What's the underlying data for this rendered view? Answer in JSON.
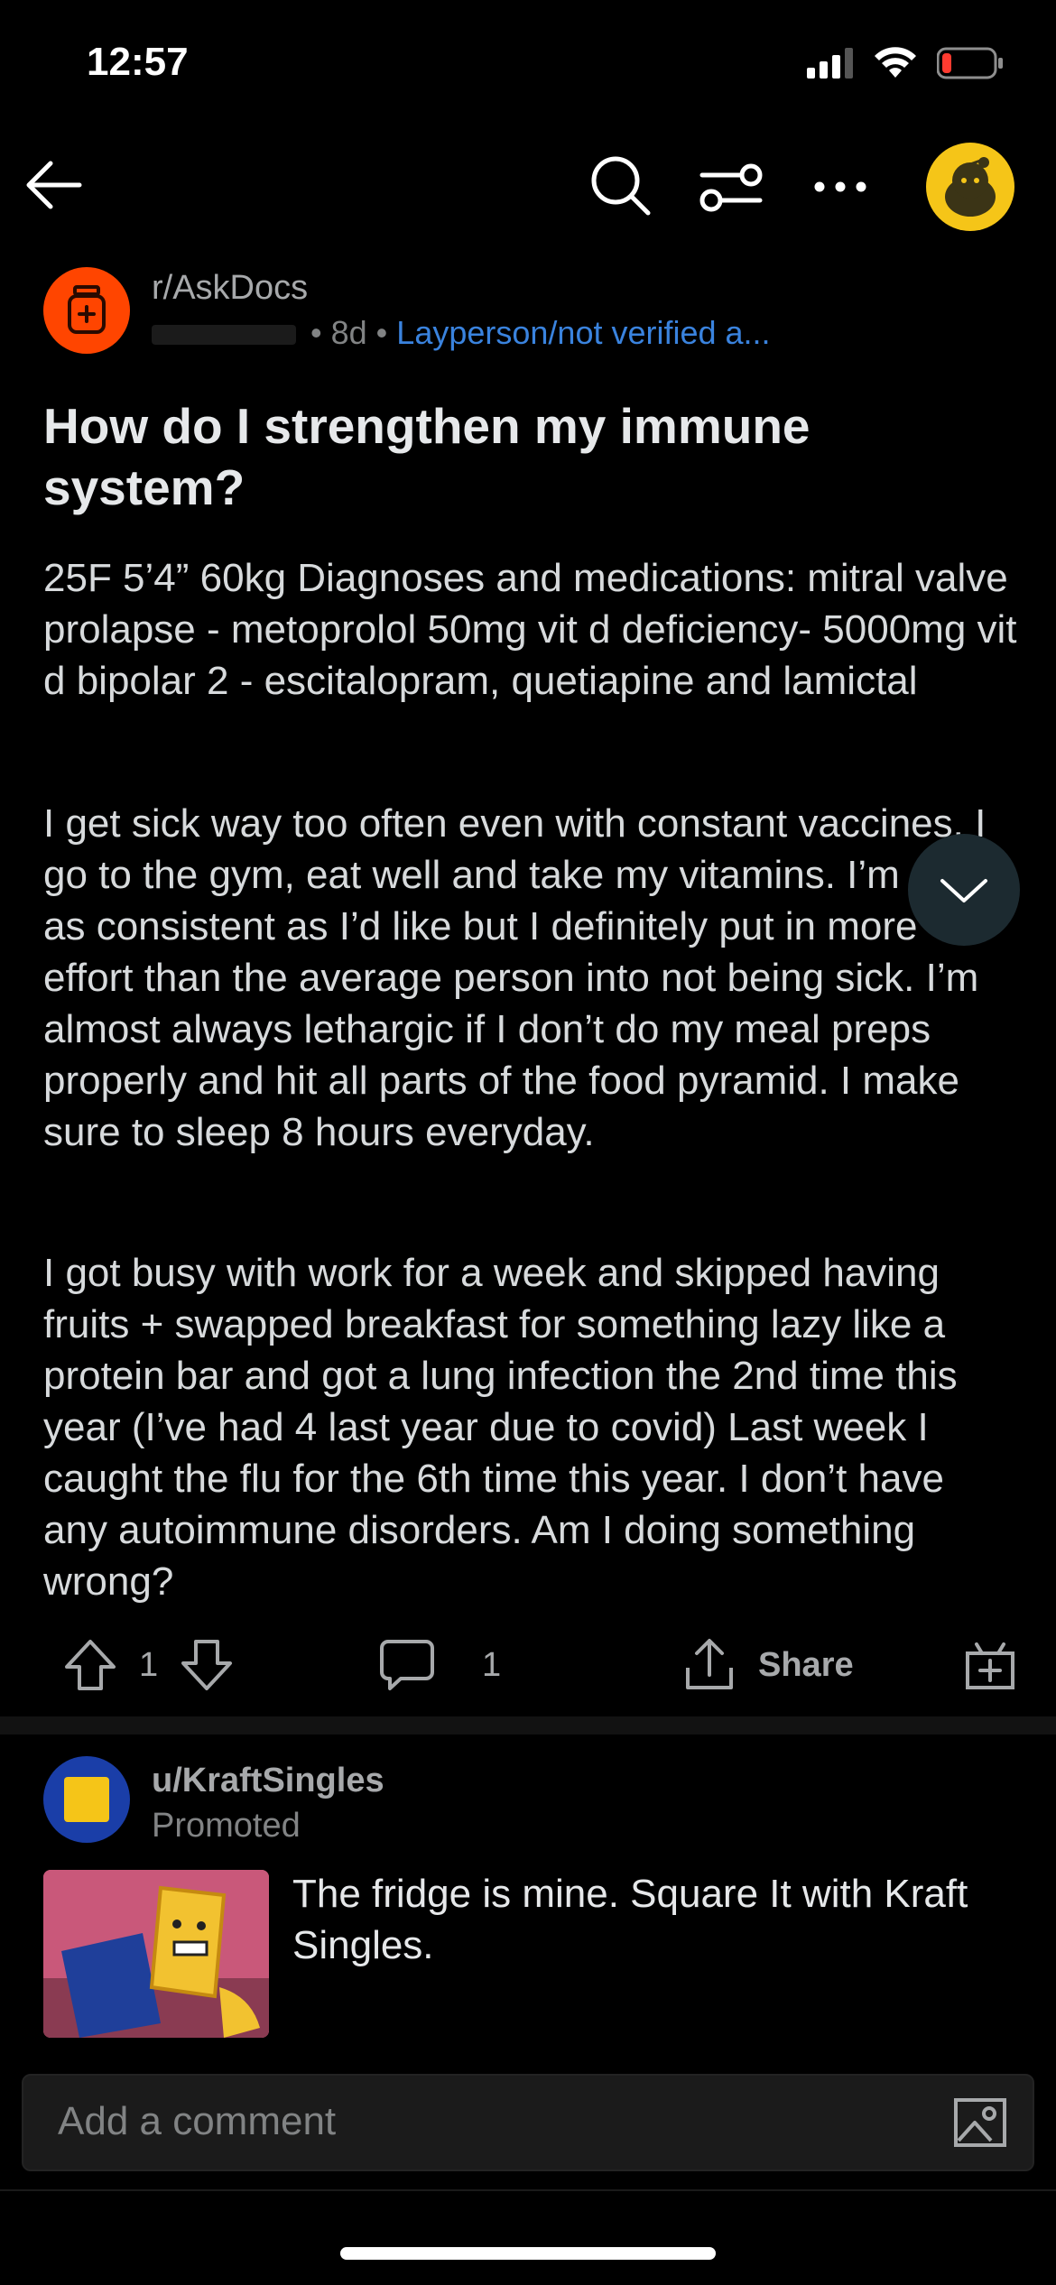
{
  "status_bar": {
    "time": "12:57"
  },
  "nav": {
    "back_icon": "arrow-left-icon",
    "search_icon": "search-icon",
    "sort_icon": "sliders-icon",
    "more_icon": "ellipsis-icon",
    "avatar_icon": "snoo-avatar-icon"
  },
  "post": {
    "subreddit": "r/AskDocs",
    "username_blurred": "u",
    "age": "• 8d •",
    "flair": "Layperson/not verified a...",
    "title": "How do I strengthen my immune system?",
    "paragraphs": [
      "25F 5’4” 60kg Diagnoses and medications: mitral valve prolapse - metoprolol 50mg vit d deficiency- 5000mg vit d bipolar 2 - escitalopram, quetiapine and lamictal",
      "I get sick way too often even with constant vaccines. I go to the gym, eat well and take my vitamins. I’m not as consistent as I’d like but I definitely put in more effort than the average person into not being sick. I’m almost always lethargic if I don’t do my meal preps properly and hit all parts of the food pyramid. I make sure to sleep 8 hours everyday.",
      "I got busy with work for a week and skipped having fruits + swapped breakfast for something lazy like a protein bar and got a lung infection the 2nd time this year (I’ve had 4 last year due to covid) Last week I caught the flu for the 6th time this year. I don’t have any autoimmune disorders. Am I doing something wrong?"
    ],
    "vote_count": "1",
    "comment_count": "1",
    "share_label": "Share"
  },
  "promoted": {
    "user": "u/KraftSingles",
    "label": "Promoted",
    "text": "The fridge is mine. Square It with Kraft Singles."
  },
  "comment_bar": {
    "placeholder": "Add a comment"
  },
  "colors": {
    "background": "#000000",
    "flair_blue": "#3a83de",
    "subreddit_orange": "#ff4500",
    "avatar_yellow": "#f5c518"
  }
}
